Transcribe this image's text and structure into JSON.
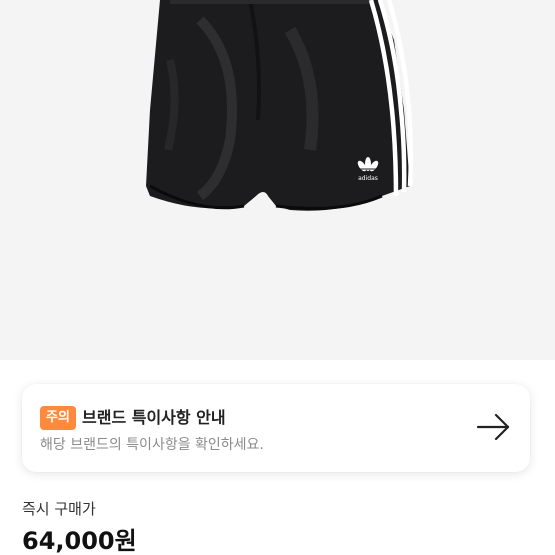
{
  "product": {
    "image_icon": "adidas-shorts-image",
    "logo_text": "adidas"
  },
  "notice": {
    "badge": "주의",
    "title": "브랜드 특이사항 안내",
    "description": "해당 브랜드의 특이사항을 확인하세요.",
    "arrow_icon": "arrow-right-icon",
    "badge_color": "#ff8a3c"
  },
  "price": {
    "label": "즉시 구매가",
    "value": "64,000원"
  }
}
